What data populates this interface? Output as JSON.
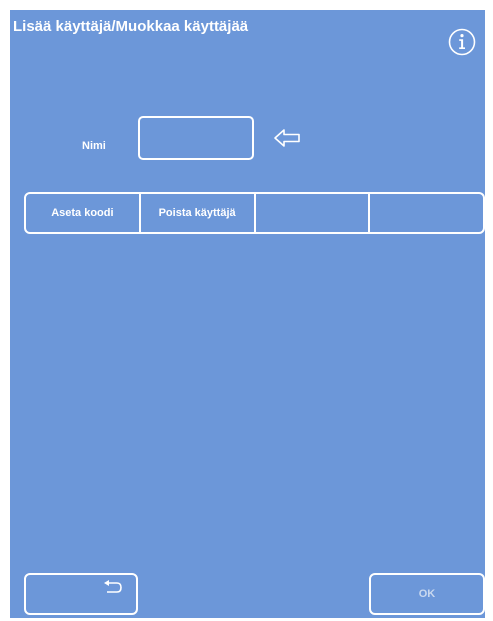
{
  "header": {
    "title": "Lisää käyttäjä/Muokkaa käyttäjää",
    "info_icon": "info-icon"
  },
  "form": {
    "name_label": "Nimi",
    "name_value": "",
    "arrow_icon": "arrow-left-icon"
  },
  "actions": [
    {
      "label": "Aseta koodi"
    },
    {
      "label": "Poista käyttäjä"
    },
    {
      "label": ""
    },
    {
      "label": ""
    }
  ],
  "footer": {
    "back_icon": "return-icon",
    "ok_label": "OK"
  },
  "colors": {
    "background": "#6c97d9",
    "foreground": "#ffffff",
    "disabled_text": "#c9d8ef"
  }
}
